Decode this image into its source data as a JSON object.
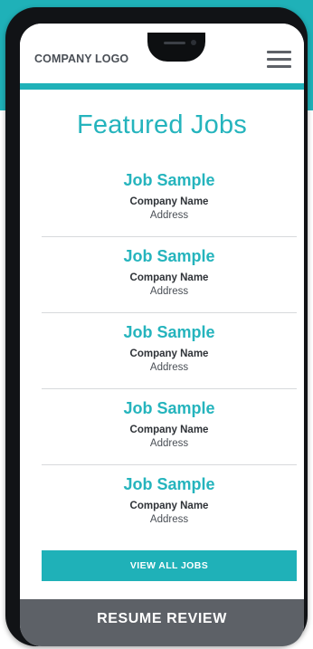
{
  "header": {
    "logo": "COMPANY LOGO",
    "menu_icon": "hamburger-menu-icon"
  },
  "main": {
    "title": "Featured Jobs",
    "jobs": [
      {
        "title": "Job Sample",
        "company": "Company Name",
        "address": "Address"
      },
      {
        "title": "Job Sample",
        "company": "Company Name",
        "address": "Address"
      },
      {
        "title": "Job Sample",
        "company": "Company Name",
        "address": "Address"
      },
      {
        "title": "Job Sample",
        "company": "Company Name",
        "address": "Address"
      },
      {
        "title": "Job Sample",
        "company": "Company Name",
        "address": "Address"
      }
    ],
    "view_all_label": "VIEW ALL JOBS"
  },
  "footer": {
    "resume_label": "RESUME REVIEW"
  },
  "colors": {
    "accent": "#1fb1b8",
    "title_teal": "#25b4bd",
    "footer_gray": "#5d6167",
    "phone_frame": "#111316"
  }
}
